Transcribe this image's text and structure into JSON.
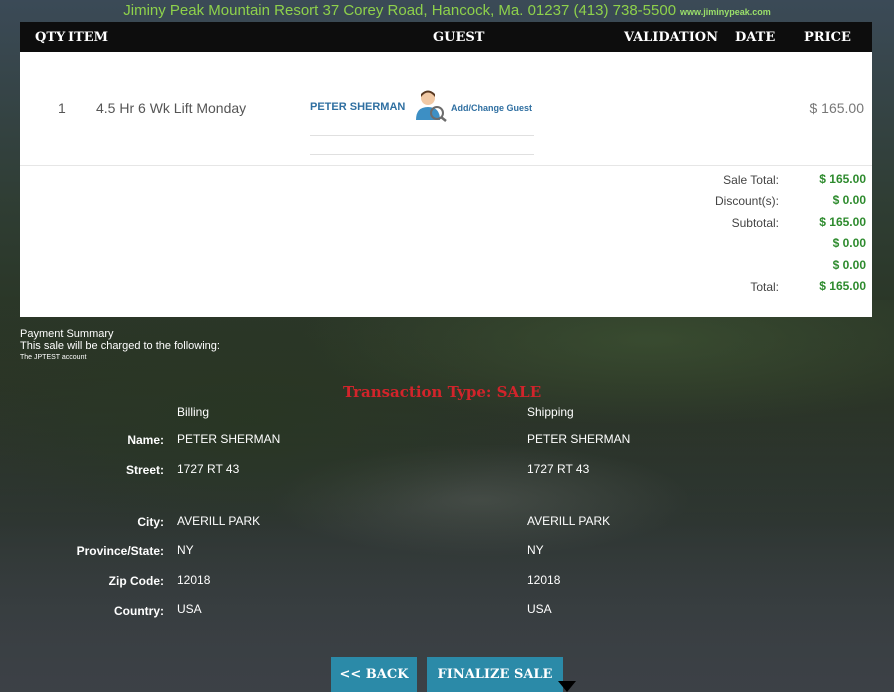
{
  "header": {
    "address_text": "Jiminy Peak Mountain Resort 37 Corey Road, Hancock, Ma. 01237 (413) 738-5500",
    "url_text": "www.jiminypeak.com"
  },
  "cart": {
    "columns": {
      "qty": "QTY",
      "item": "ITEM",
      "guest": "GUEST",
      "validation": "VALIDATION",
      "date": "DATE",
      "price": "PRICE"
    },
    "item": {
      "qty": "1",
      "name": "4.5 Hr 6 Wk Lift Monday",
      "guest_name": "PETER SHERMAN",
      "add_change_label": "Add/Change Guest",
      "price": "$ 165.00"
    },
    "totals": [
      {
        "label": "Sale Total:",
        "value": "$ 165.00"
      },
      {
        "label": "Discount(s):",
        "value": "$ 0.00"
      },
      {
        "label": "Subtotal:",
        "value": "$ 165.00"
      },
      {
        "label": "",
        "value": "$ 0.00"
      },
      {
        "label": "",
        "value": "$ 0.00"
      },
      {
        "label": "Total:",
        "value": "$ 165.00"
      }
    ]
  },
  "payment": {
    "title": "Payment Summary",
    "description": "This sale will be charged to the following:",
    "account": "The JPTEST account"
  },
  "transaction_type": "Transaction Type: SALE",
  "address": {
    "billing_header": "Billing",
    "shipping_header": "Shipping",
    "labels": {
      "name": "Name:",
      "street": "Street:",
      "city": "City:",
      "province": "Province/State:",
      "zip": "Zip Code:",
      "country": "Country:"
    },
    "billing": {
      "name": "PETER SHERMAN",
      "street": "1727 RT 43",
      "city": "AVERILL PARK",
      "province": "NY",
      "zip": "12018",
      "country": "USA"
    },
    "shipping": {
      "name": "PETER SHERMAN",
      "street": "1727 RT 43",
      "city": "AVERILL PARK",
      "province": "NY",
      "zip": "12018",
      "country": "USA"
    }
  },
  "buttons": {
    "back": "<< BACK",
    "finalize": "FINALIZE SALE"
  },
  "colors": {
    "accent": "#2b8aa8",
    "price_green": "#2e8b2e",
    "transaction_red": "#d1242b",
    "header_green": "#8ed14b"
  }
}
